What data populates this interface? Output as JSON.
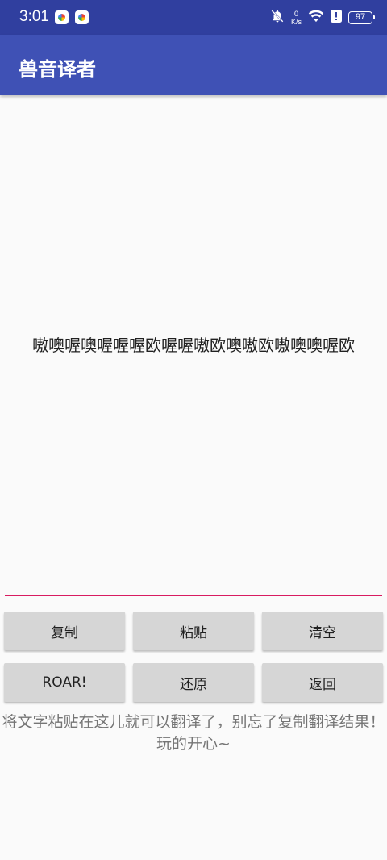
{
  "status_bar": {
    "time": "3:01",
    "net_speed_value": "0",
    "net_speed_unit": "K/s",
    "battery_level": "97",
    "icons": [
      "app-notification-icon",
      "app-notification-icon",
      "notifications-off-icon",
      "wifi-icon",
      "alert-icon",
      "battery-icon"
    ]
  },
  "app_bar": {
    "title": "兽音译者"
  },
  "output": {
    "text": "嗷噢喔噢喔喔喔欧喔喔嗷欧噢嗷欧嗷噢噢喔欧"
  },
  "buttons": {
    "copy": "复制",
    "paste": "粘贴",
    "clear": "清空",
    "roar": "ROAR!",
    "restore": "还原",
    "back": "返回"
  },
  "hint": "将文字粘贴在这儿就可以翻译了，别忘了复制翻译结果！玩的开心~",
  "colors": {
    "status_bar": "#303f9f",
    "app_bar": "#3f51b5",
    "accent": "#d81b60",
    "button": "#d6d6d6"
  }
}
